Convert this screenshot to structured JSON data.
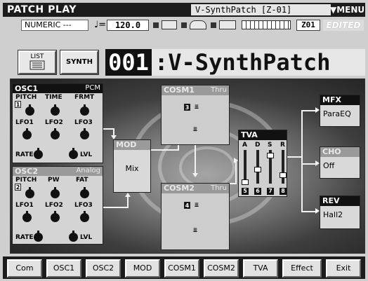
{
  "header": {
    "title": "PATCH PLAY",
    "patch_box": "V-SynthPatch [Z-01]",
    "menu_label": "▼MENU"
  },
  "info": {
    "numeric": "NUMERIC  ---",
    "tempo_symbol": "♩=",
    "tempo": "120.0",
    "bank": "Z01",
    "edited": "EDITED"
  },
  "patch": {
    "number": "001",
    "name": ":V-SynthPatch"
  },
  "buttons": {
    "list": "LIST",
    "synth": "SYNTH"
  },
  "osc1": {
    "title": "OSC1",
    "type": "PCM",
    "row1": [
      "PITCH",
      "TIME",
      "FRMT"
    ],
    "row2": [
      "LFO1",
      "LFO2",
      "LFO3"
    ],
    "rate": "RATE",
    "lvl": "LVL",
    "tag": "1"
  },
  "osc2": {
    "title": "OSC2",
    "type": "Analog",
    "row1": [
      "PITCH",
      "PW",
      "FAT"
    ],
    "row2": [
      "LFO1",
      "LFO2",
      "LFO3"
    ],
    "rate": "RATE",
    "lvl": "LVL",
    "tag": "2"
  },
  "mod": {
    "title": "MOD",
    "value": "Mix"
  },
  "cosm1": {
    "title": "COSM1",
    "mode": "Thru",
    "tag": "3"
  },
  "cosm2": {
    "title": "COSM2",
    "mode": "Thru",
    "tag": "4"
  },
  "tva": {
    "title": "TVA",
    "sliders": [
      "A",
      "D",
      "S",
      "R"
    ],
    "numbers": [
      "5",
      "6",
      "7",
      "8"
    ]
  },
  "mfx": {
    "title": "MFX",
    "value": "ParaEQ"
  },
  "cho": {
    "title": "CHO",
    "value": "Off"
  },
  "rev": {
    "title": "REV",
    "value": "Hall2"
  },
  "tabs": [
    "Com",
    "OSC1",
    "OSC2",
    "MOD",
    "COSM1",
    "COSM2",
    "TVA",
    "Effect",
    "Exit"
  ]
}
